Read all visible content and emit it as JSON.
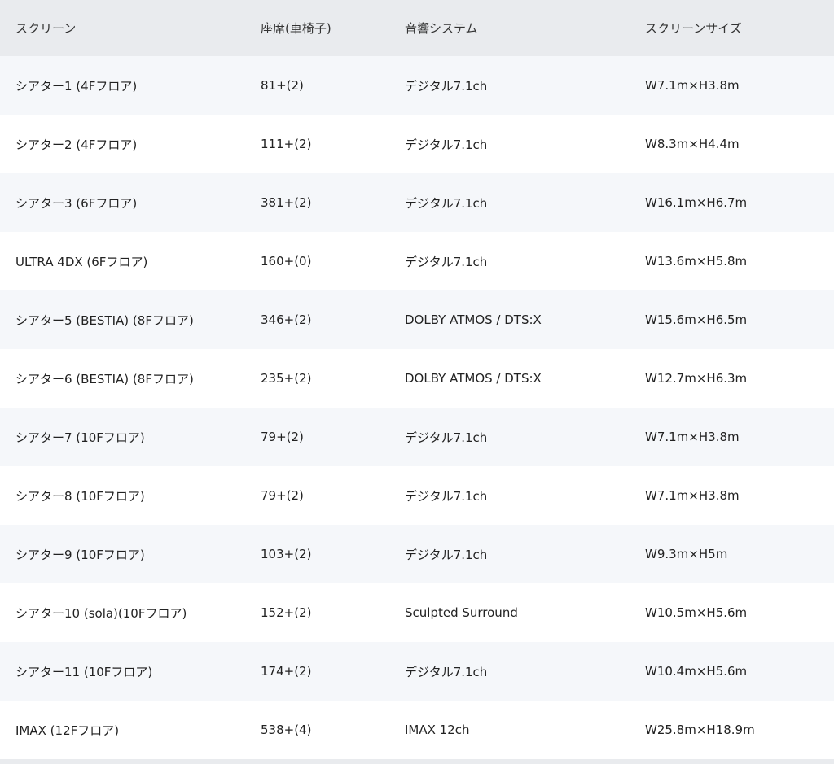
{
  "table": {
    "headers": [
      "スクリーン",
      "座席(車椅子)",
      "音響システム",
      "スクリーンサイズ"
    ],
    "rows": [
      [
        "シアター1 (4Fフロア)",
        "81+(2)",
        "デジタル7.1ch",
        "W7.1m×H3.8m"
      ],
      [
        "シアター2 (4Fフロア)",
        "111+(2)",
        "デジタル7.1ch",
        "W8.3m×H4.4m"
      ],
      [
        "シアター3 (6Fフロア)",
        "381+(2)",
        "デジタル7.1ch",
        "W16.1m×H6.7m"
      ],
      [
        "ULTRA 4DX (6Fフロア)",
        "160+(0)",
        "デジタル7.1ch",
        "W13.6m×H5.8m"
      ],
      [
        "シアター5 (BESTIA) (8Fフロア)",
        "346+(2)",
        "DOLBY ATMOS / DTS:X",
        "W15.6m×H6.5m"
      ],
      [
        "シアター6 (BESTIA) (8Fフロア)",
        "235+(2)",
        "DOLBY ATMOS / DTS:X",
        "W12.7m×H6.3m"
      ],
      [
        "シアター7 (10Fフロア)",
        "79+(2)",
        "デジタル7.1ch",
        "W7.1m×H3.8m"
      ],
      [
        "シアター8 (10Fフロア)",
        "79+(2)",
        "デジタル7.1ch",
        "W7.1m×H3.8m"
      ],
      [
        "シアター9 (10Fフロア)",
        "103+(2)",
        "デジタル7.1ch",
        "W9.3m×H5m"
      ],
      [
        "シアター10 (sola)(10Fフロア)",
        "152+(2)",
        "Sculpted Surround",
        "W10.5m×H5.6m"
      ],
      [
        "シアター11 (10Fフロア)",
        "174+(2)",
        "デジタル7.1ch",
        "W10.4m×H5.6m"
      ],
      [
        "IMAX (12Fフロア)",
        "538+(4)",
        "IMAX 12ch",
        "W25.8m×H18.9m"
      ]
    ]
  },
  "colors": {
    "header_bg": "#e9ebee",
    "row_alt_bg": "#f5f7fa",
    "row_bg": "#ffffff",
    "text": "#222222"
  }
}
